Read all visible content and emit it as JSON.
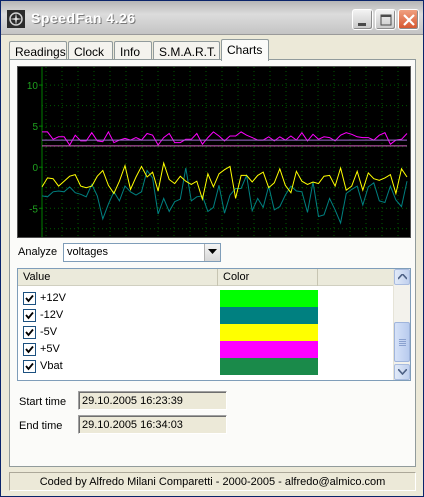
{
  "window": {
    "title": "SpeedFan 4.26"
  },
  "tabs": [
    {
      "label": "Readings"
    },
    {
      "label": "Clock"
    },
    {
      "label": "Info"
    },
    {
      "label": "S.M.A.R.T."
    },
    {
      "label": "Charts"
    }
  ],
  "active_tab": "Charts",
  "colors": {
    "+12V": "#00ff00",
    "-12V": "#008080",
    "-5V": "#ffff00",
    "+5V": "#ff00ff",
    "Vbat": "#1a8a4a",
    "grid": "#005a00",
    "axis": "#008000"
  },
  "chart_data": {
    "type": "line",
    "y_ticks": [
      "10",
      "5",
      "0",
      "-5"
    ],
    "ylim": [
      -8.5,
      12.2
    ],
    "grid": true,
    "series": [
      {
        "name": "+12V",
        "color": "#00ff00",
        "values": []
      },
      {
        "name": "-12V",
        "color": "#008080",
        "values": [
          -3.5,
          -3.6,
          -3.0,
          -2.9,
          -3.0,
          -2.4,
          -3.1,
          -3.3,
          -3.6,
          -2.1,
          -3.5,
          -6.3,
          -4.5,
          -3.0,
          -4.1,
          -2.3,
          -3.0,
          -3.4,
          -3.0,
          -0.4,
          -1.3,
          -5.7,
          -3.8,
          -5.4,
          -4.2,
          -3.9,
          -0.1,
          -4.1,
          -3.6,
          -3.5,
          -5.4,
          -4.9,
          -2.2,
          -5.6,
          -3.4,
          -2.6,
          -2.6,
          -1.0,
          -5.3,
          -3.8,
          -4.9,
          -2.3,
          -5.2,
          -4.8,
          -3.4,
          -2.3,
          -2.9,
          -3.0,
          -5.5,
          -1.8,
          -6.0,
          -5.8,
          -3.8,
          -5.2,
          -6.8,
          -3.2,
          -2.7,
          -2.3,
          -4.6,
          -2.4,
          -1.9,
          -4.1,
          -4.3,
          -2.3,
          -4.0,
          -4.8,
          -1.7
        ]
      },
      {
        "name": "-5V",
        "color": "#ffff00",
        "values": [
          -2.4,
          -1.3,
          -1.4,
          -2.3,
          -1.7,
          -1.1,
          -0.9,
          -2.3,
          -2.5,
          -2.3,
          -1.1,
          -0.4,
          -2.2,
          -3.2,
          -1.7,
          0.2,
          -2.7,
          -1.2,
          0.1,
          -1.2,
          -0.6,
          -2.9,
          0.5,
          -1.5,
          -2.0,
          -1.1,
          -1.7,
          -2.1,
          -1.7,
          -3.9,
          -0.8,
          -2.4,
          -0.8,
          -0.3,
          0.1,
          -3.8,
          -1.0,
          -1.0,
          -1.8,
          -1.0,
          -0.6,
          -2.5,
          -1.9,
          -0.2,
          -2.2,
          -3.1,
          -0.5,
          -1.7,
          -2.1,
          -1.8,
          -2.0,
          -1.1,
          -1.0,
          -2.3,
          -0.1,
          -2.8,
          -2.3,
          -0.5,
          -2.8,
          -0.7,
          -1.4,
          -1.6,
          -1.3,
          -0.9,
          -3.2,
          -0.2,
          -1.2
        ]
      },
      {
        "name": "+5V",
        "color": "#ff00ff",
        "values": [
          4.3,
          4.3,
          3.4,
          3.7,
          3.7,
          2.7,
          3.9,
          3.2,
          3.2,
          4.2,
          3.2,
          3.1,
          4.3,
          3.0,
          3.3,
          3.5,
          3.3,
          3.6,
          3.3,
          4.1,
          3.9,
          2.7,
          3.6,
          4.1,
          3.0,
          3.0,
          3.4,
          3.4,
          4.1,
          2.8,
          3.6,
          4.3,
          3.8,
          3.2,
          3.8,
          3.8,
          4.3,
          3.9,
          3.6,
          3.3,
          3.3,
          3.7,
          3.2,
          3.7,
          3.3,
          3.8,
          3.3,
          4.2,
          3.2,
          4.0,
          3.4,
          3.7,
          3.6,
          3.2,
          3.9,
          4.2,
          4.0,
          3.7,
          3.6,
          3.6,
          3.3,
          3.9,
          4.2,
          2.8,
          3.3,
          3.4,
          4.1
        ]
      },
      {
        "name": "Vbat",
        "color": "#1a8a4a",
        "values": []
      }
    ]
  },
  "analyze": {
    "label": "Analyze",
    "value": "voltages"
  },
  "list": {
    "columns": [
      "Value",
      "Color",
      ""
    ],
    "rows": [
      {
        "label": "+12V",
        "checked": true,
        "color": "#00ff00"
      },
      {
        "label": "-12V",
        "checked": true,
        "color": "#008080"
      },
      {
        "label": "-5V",
        "checked": true,
        "color": "#ffff00"
      },
      {
        "label": "+5V",
        "checked": true,
        "color": "#ff00ff"
      },
      {
        "label": "Vbat",
        "checked": true,
        "color": "#1a8a4a"
      }
    ]
  },
  "times": {
    "start_label": "Start time",
    "start_value": "29.10.2005 16:23:39",
    "end_label": "End time",
    "end_value": "29.10.2005 16:34:03"
  },
  "status": {
    "text": "Coded by Alfredo Milani Comparetti - 2000-2005 - alfredo@almico.com"
  }
}
